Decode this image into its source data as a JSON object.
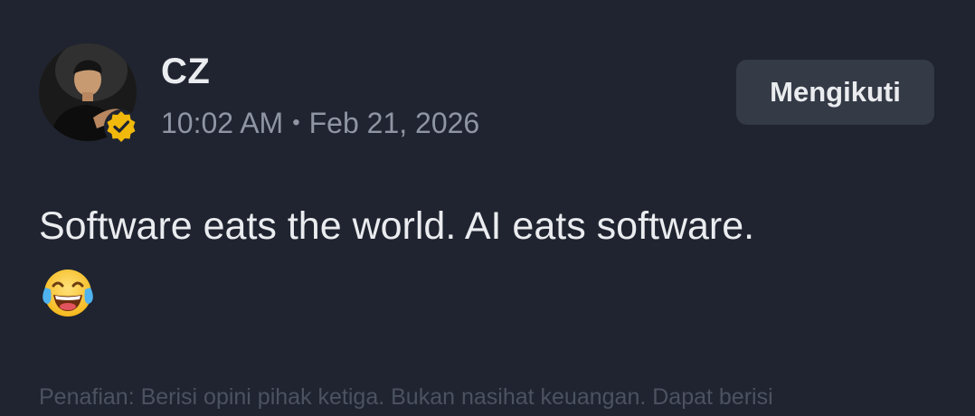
{
  "post": {
    "author": {
      "name": "CZ",
      "verified": true,
      "avatar_icon": "user-photo"
    },
    "time": "10:02 AM",
    "separator": "•",
    "date": "Feb 21, 2026",
    "follow_button": {
      "label": "Mengikuti"
    },
    "content": {
      "text": "Software eats the world. AI eats software.",
      "emoji_icon": "face-with-tears-of-joy"
    },
    "disclaimer": "Penafian: Berisi opini pihak ketiga. Bukan nasihat keuangan. Dapat berisi"
  },
  "colors": {
    "background": "#1f2430",
    "primary_text": "#eaecef",
    "secondary_text": "#8f95a3",
    "button_bg": "#343a46",
    "verified_badge": "#f0b90b",
    "disclaimer_text": "#4c5260"
  }
}
